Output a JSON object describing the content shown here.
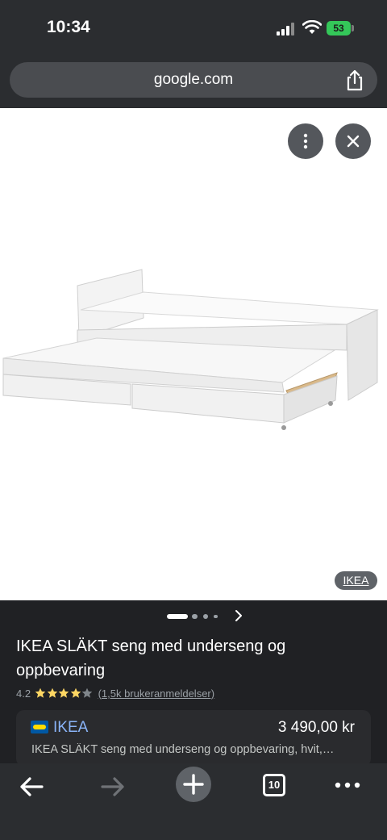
{
  "status_bar": {
    "time": "10:34",
    "battery": "53",
    "colors": {
      "battery": "#34c759"
    }
  },
  "browser": {
    "url": "google.com",
    "icons": {
      "share": "share-icon",
      "more": "more-vertical-icon",
      "close": "close-icon"
    }
  },
  "viewer": {
    "image_description_icon": "bed-image",
    "source_label": "IKEA",
    "pager": {
      "count": 4,
      "active_index": 0,
      "next_icon": "chevron-right-icon"
    }
  },
  "product": {
    "title": "IKEA SLÄKT seng med underseng og oppbevaring",
    "rating": "4.2",
    "rating_stars": 4.2,
    "stars_max": 5,
    "reviews": "(1,5k brukeranmeldelser)",
    "colors": {
      "star": "#fdd663"
    }
  },
  "offer": {
    "store": "IKEA",
    "price": "3 490,00 kr",
    "description": "IKEA SLÄKT seng med underseng og oppbevaring, hvit,…",
    "colors": {
      "store_link": "#8ab4f8"
    }
  },
  "toolbar": {
    "tabs_count": "10",
    "icons": {
      "back": "arrow-left-icon",
      "forward": "arrow-right-icon",
      "new_tab": "plus-icon",
      "tabs": "tab-switcher-icon",
      "menu": "more-horizontal-icon"
    }
  }
}
